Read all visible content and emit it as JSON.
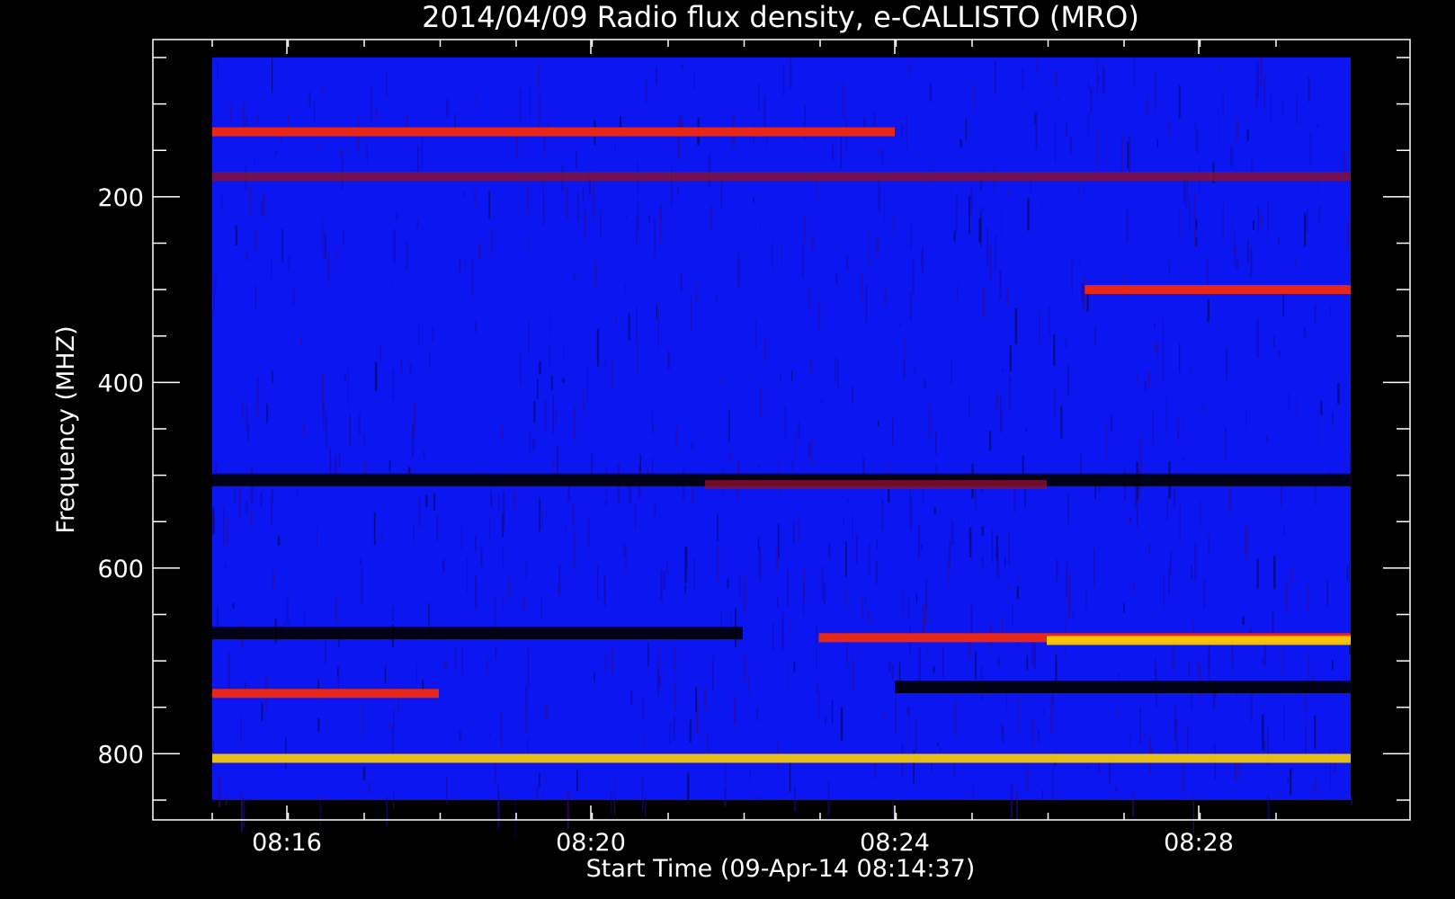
{
  "chart_data": {
    "type": "heatmap",
    "title": "2014/04/09  Radio flux density, e-CALLISTO (MRO)",
    "xlabel": "Start Time (09-Apr-14 08:14:37)",
    "ylabel": "Frequency (MHZ)",
    "x_ticks": [
      "08:16",
      "08:20",
      "08:24",
      "08:28"
    ],
    "y_ticks": [
      "200",
      "400",
      "600",
      "800"
    ],
    "x_range_minutes": [
      "08:14:37",
      "08:30:00"
    ],
    "y_range": [
      850,
      50
    ],
    "y_inverted": true,
    "colors": {
      "background": "#0b16f0",
      "band_low": "#000000",
      "band_mid": "#8a1030",
      "band_high": "#ff2a00",
      "band_peak": "#ffd000"
    },
    "intensity_bands": [
      {
        "mhz": 130,
        "start": "08:14:37",
        "end": "08:24:00",
        "level": "high"
      },
      {
        "mhz": 178,
        "start": "08:14:37",
        "end": "08:30:00",
        "level": "mid"
      },
      {
        "mhz": 300,
        "start": "08:26:30",
        "end": "08:30:00",
        "level": "high"
      },
      {
        "mhz": 505,
        "start": "08:14:37",
        "end": "08:30:00",
        "level": "low"
      },
      {
        "mhz": 510,
        "start": "08:21:30",
        "end": "08:26:00",
        "level": "mid"
      },
      {
        "mhz": 670,
        "start": "08:14:37",
        "end": "08:22:00",
        "level": "low"
      },
      {
        "mhz": 675,
        "start": "08:23:00",
        "end": "08:30:00",
        "level": "high"
      },
      {
        "mhz": 678,
        "start": "08:26:00",
        "end": "08:30:00",
        "level": "peak"
      },
      {
        "mhz": 735,
        "start": "08:14:37",
        "end": "08:18:00",
        "level": "high"
      },
      {
        "mhz": 728,
        "start": "08:24:00",
        "end": "08:30:00",
        "level": "low"
      },
      {
        "mhz": 805,
        "start": "08:14:37",
        "end": "08:30:00",
        "level": "peak"
      }
    ]
  }
}
